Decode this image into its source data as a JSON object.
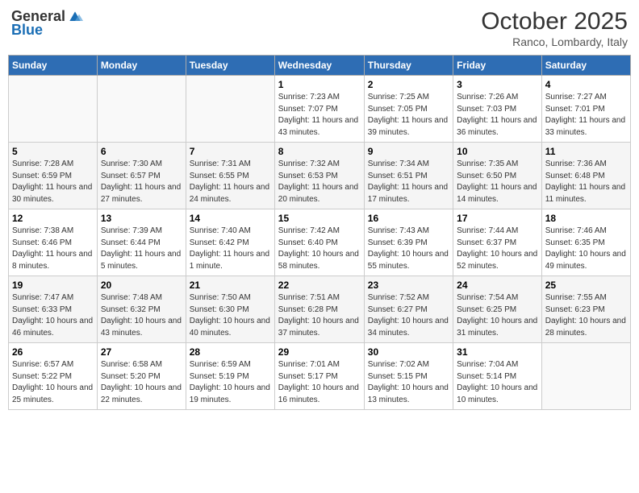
{
  "header": {
    "logo_general": "General",
    "logo_blue": "Blue",
    "month_title": "October 2025",
    "location": "Ranco, Lombardy, Italy"
  },
  "days_of_week": [
    "Sunday",
    "Monday",
    "Tuesday",
    "Wednesday",
    "Thursday",
    "Friday",
    "Saturday"
  ],
  "weeks": [
    [
      {
        "day": "",
        "info": ""
      },
      {
        "day": "",
        "info": ""
      },
      {
        "day": "",
        "info": ""
      },
      {
        "day": "1",
        "info": "Sunrise: 7:23 AM\nSunset: 7:07 PM\nDaylight: 11 hours and 43 minutes."
      },
      {
        "day": "2",
        "info": "Sunrise: 7:25 AM\nSunset: 7:05 PM\nDaylight: 11 hours and 39 minutes."
      },
      {
        "day": "3",
        "info": "Sunrise: 7:26 AM\nSunset: 7:03 PM\nDaylight: 11 hours and 36 minutes."
      },
      {
        "day": "4",
        "info": "Sunrise: 7:27 AM\nSunset: 7:01 PM\nDaylight: 11 hours and 33 minutes."
      }
    ],
    [
      {
        "day": "5",
        "info": "Sunrise: 7:28 AM\nSunset: 6:59 PM\nDaylight: 11 hours and 30 minutes."
      },
      {
        "day": "6",
        "info": "Sunrise: 7:30 AM\nSunset: 6:57 PM\nDaylight: 11 hours and 27 minutes."
      },
      {
        "day": "7",
        "info": "Sunrise: 7:31 AM\nSunset: 6:55 PM\nDaylight: 11 hours and 24 minutes."
      },
      {
        "day": "8",
        "info": "Sunrise: 7:32 AM\nSunset: 6:53 PM\nDaylight: 11 hours and 20 minutes."
      },
      {
        "day": "9",
        "info": "Sunrise: 7:34 AM\nSunset: 6:51 PM\nDaylight: 11 hours and 17 minutes."
      },
      {
        "day": "10",
        "info": "Sunrise: 7:35 AM\nSunset: 6:50 PM\nDaylight: 11 hours and 14 minutes."
      },
      {
        "day": "11",
        "info": "Sunrise: 7:36 AM\nSunset: 6:48 PM\nDaylight: 11 hours and 11 minutes."
      }
    ],
    [
      {
        "day": "12",
        "info": "Sunrise: 7:38 AM\nSunset: 6:46 PM\nDaylight: 11 hours and 8 minutes."
      },
      {
        "day": "13",
        "info": "Sunrise: 7:39 AM\nSunset: 6:44 PM\nDaylight: 11 hours and 5 minutes."
      },
      {
        "day": "14",
        "info": "Sunrise: 7:40 AM\nSunset: 6:42 PM\nDaylight: 11 hours and 1 minute."
      },
      {
        "day": "15",
        "info": "Sunrise: 7:42 AM\nSunset: 6:40 PM\nDaylight: 10 hours and 58 minutes."
      },
      {
        "day": "16",
        "info": "Sunrise: 7:43 AM\nSunset: 6:39 PM\nDaylight: 10 hours and 55 minutes."
      },
      {
        "day": "17",
        "info": "Sunrise: 7:44 AM\nSunset: 6:37 PM\nDaylight: 10 hours and 52 minutes."
      },
      {
        "day": "18",
        "info": "Sunrise: 7:46 AM\nSunset: 6:35 PM\nDaylight: 10 hours and 49 minutes."
      }
    ],
    [
      {
        "day": "19",
        "info": "Sunrise: 7:47 AM\nSunset: 6:33 PM\nDaylight: 10 hours and 46 minutes."
      },
      {
        "day": "20",
        "info": "Sunrise: 7:48 AM\nSunset: 6:32 PM\nDaylight: 10 hours and 43 minutes."
      },
      {
        "day": "21",
        "info": "Sunrise: 7:50 AM\nSunset: 6:30 PM\nDaylight: 10 hours and 40 minutes."
      },
      {
        "day": "22",
        "info": "Sunrise: 7:51 AM\nSunset: 6:28 PM\nDaylight: 10 hours and 37 minutes."
      },
      {
        "day": "23",
        "info": "Sunrise: 7:52 AM\nSunset: 6:27 PM\nDaylight: 10 hours and 34 minutes."
      },
      {
        "day": "24",
        "info": "Sunrise: 7:54 AM\nSunset: 6:25 PM\nDaylight: 10 hours and 31 minutes."
      },
      {
        "day": "25",
        "info": "Sunrise: 7:55 AM\nSunset: 6:23 PM\nDaylight: 10 hours and 28 minutes."
      }
    ],
    [
      {
        "day": "26",
        "info": "Sunrise: 6:57 AM\nSunset: 5:22 PM\nDaylight: 10 hours and 25 minutes."
      },
      {
        "day": "27",
        "info": "Sunrise: 6:58 AM\nSunset: 5:20 PM\nDaylight: 10 hours and 22 minutes."
      },
      {
        "day": "28",
        "info": "Sunrise: 6:59 AM\nSunset: 5:19 PM\nDaylight: 10 hours and 19 minutes."
      },
      {
        "day": "29",
        "info": "Sunrise: 7:01 AM\nSunset: 5:17 PM\nDaylight: 10 hours and 16 minutes."
      },
      {
        "day": "30",
        "info": "Sunrise: 7:02 AM\nSunset: 5:15 PM\nDaylight: 10 hours and 13 minutes."
      },
      {
        "day": "31",
        "info": "Sunrise: 7:04 AM\nSunset: 5:14 PM\nDaylight: 10 hours and 10 minutes."
      },
      {
        "day": "",
        "info": ""
      }
    ]
  ]
}
